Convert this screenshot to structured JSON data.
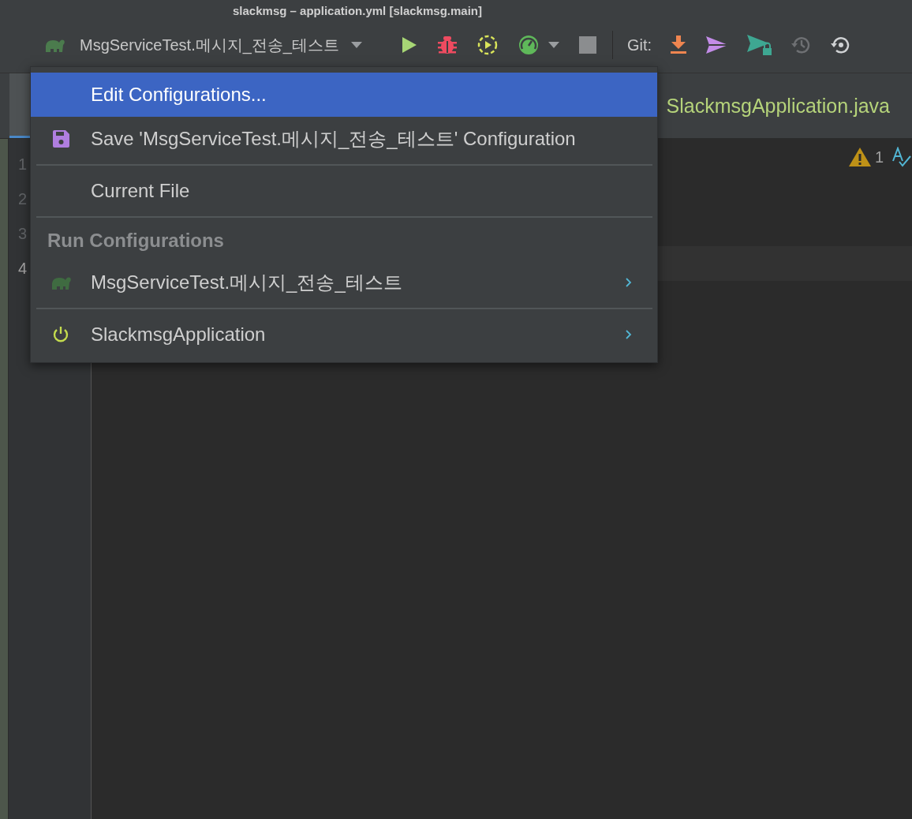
{
  "window": {
    "title": "slackmsg – application.yml [slackmsg.main]"
  },
  "toolbar": {
    "run_config": "MsgServiceTest.메시지_전송_테스트",
    "git_label": "Git:"
  },
  "editor": {
    "tab": "SlackmsgApplication.java",
    "warning_count": "1",
    "lines": [
      {
        "number": "1",
        "current": false
      },
      {
        "number": "2",
        "current": false
      },
      {
        "number": "3",
        "current": false
      },
      {
        "number": "4",
        "current": true
      }
    ]
  },
  "menu": {
    "items": [
      {
        "kind": "action",
        "label": "Edit Configurations...",
        "selected": true,
        "submenu": false,
        "separator_after": false
      },
      {
        "kind": "action",
        "label": "Save 'MsgServiceTest.메시지_전송_테스트' Configuration",
        "selected": false,
        "submenu": false,
        "separator_after": true
      },
      {
        "kind": "action",
        "label": "Current File",
        "selected": false,
        "submenu": false,
        "separator_after": true
      },
      {
        "kind": "header",
        "label": "Run Configurations"
      },
      {
        "kind": "action",
        "label": "MsgServiceTest.메시지_전송_테스트",
        "selected": false,
        "submenu": true,
        "separator_after": true
      },
      {
        "kind": "action",
        "label": "SlackmsgApplication",
        "selected": false,
        "submenu": true,
        "separator_after": false
      }
    ]
  }
}
